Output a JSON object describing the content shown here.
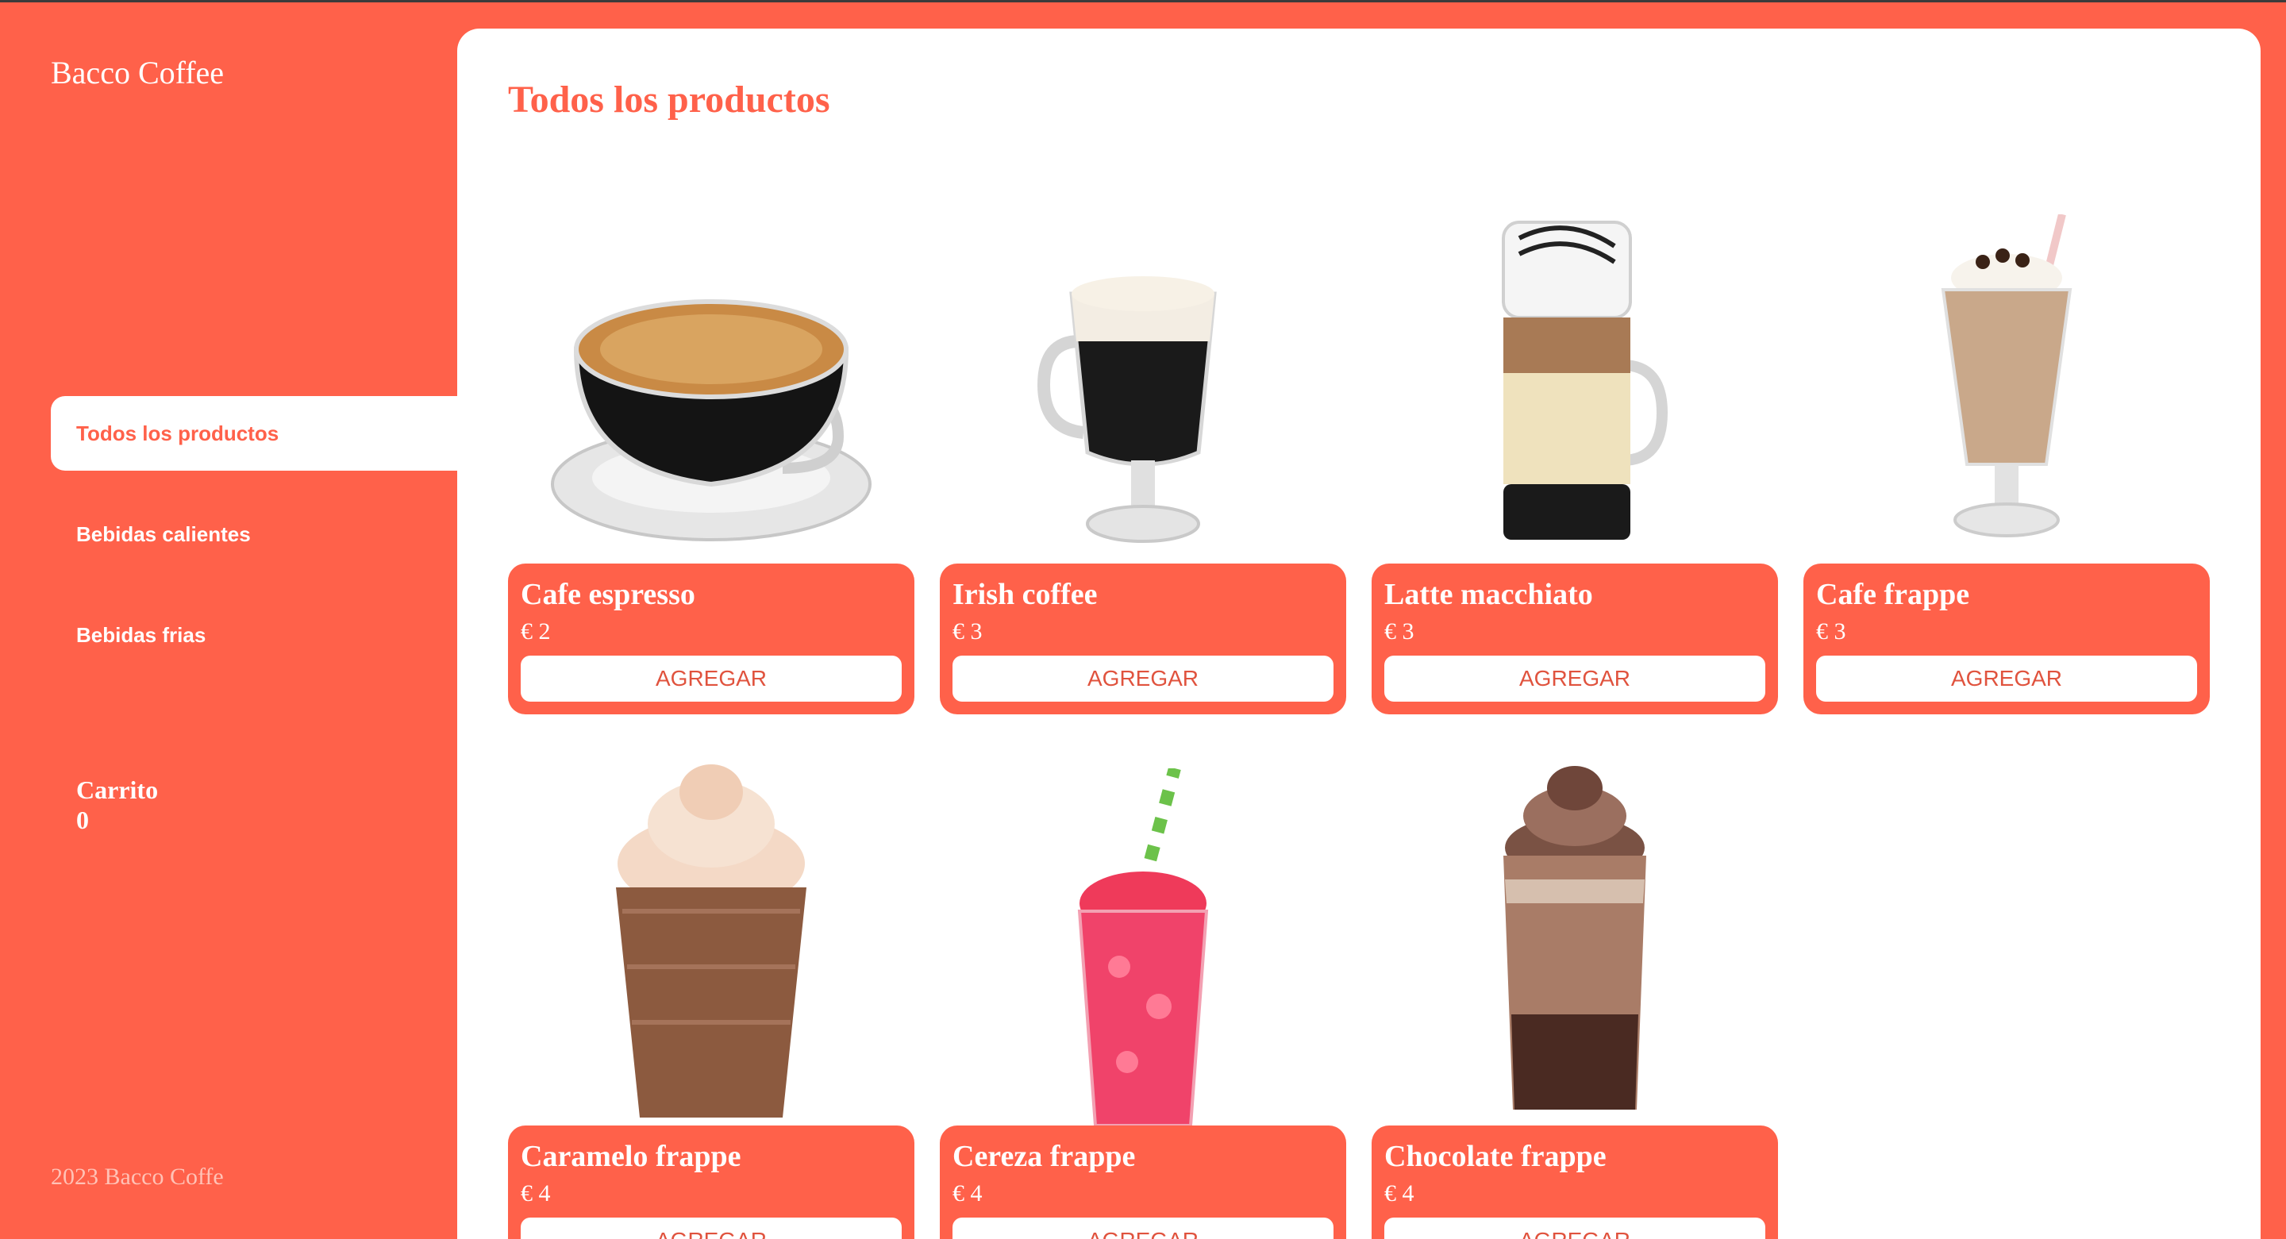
{
  "brand": "Bacco Coffee",
  "nav": [
    {
      "label": "Todos los productos",
      "active": true
    },
    {
      "label": "Bebidas calientes",
      "active": false
    },
    {
      "label": "Bebidas frias",
      "active": false
    }
  ],
  "cart": {
    "label": "Carrito",
    "count": "0"
  },
  "footer": "2023 Bacco Coffe",
  "page_title": "Todos los productos",
  "products": [
    {
      "name": "Cafe espresso",
      "price": "€ 2",
      "button": "AGREGAR",
      "icon": "espresso-cup-icon"
    },
    {
      "name": "Irish coffee",
      "price": "€ 3",
      "button": "AGREGAR",
      "icon": "irish-coffee-glass-icon"
    },
    {
      "name": "Latte macchiato",
      "price": "€ 3",
      "button": "AGREGAR",
      "icon": "latte-glass-icon"
    },
    {
      "name": "Cafe frappe",
      "price": "€ 3",
      "button": "AGREGAR",
      "icon": "frappe-glass-icon"
    },
    {
      "name": "Caramelo frappe",
      "price": "€ 4",
      "button": "AGREGAR",
      "icon": "caramel-frappe-cup-icon"
    },
    {
      "name": "Cereza frappe",
      "price": "€ 4",
      "button": "AGREGAR",
      "icon": "cherry-slush-cup-icon"
    },
    {
      "name": "Chocolate frappe",
      "price": "€ 4",
      "button": "AGREGAR",
      "icon": "chocolate-frappe-cup-icon"
    }
  ],
  "colors": {
    "accent": "#ff614a",
    "background": "#ffffff"
  }
}
